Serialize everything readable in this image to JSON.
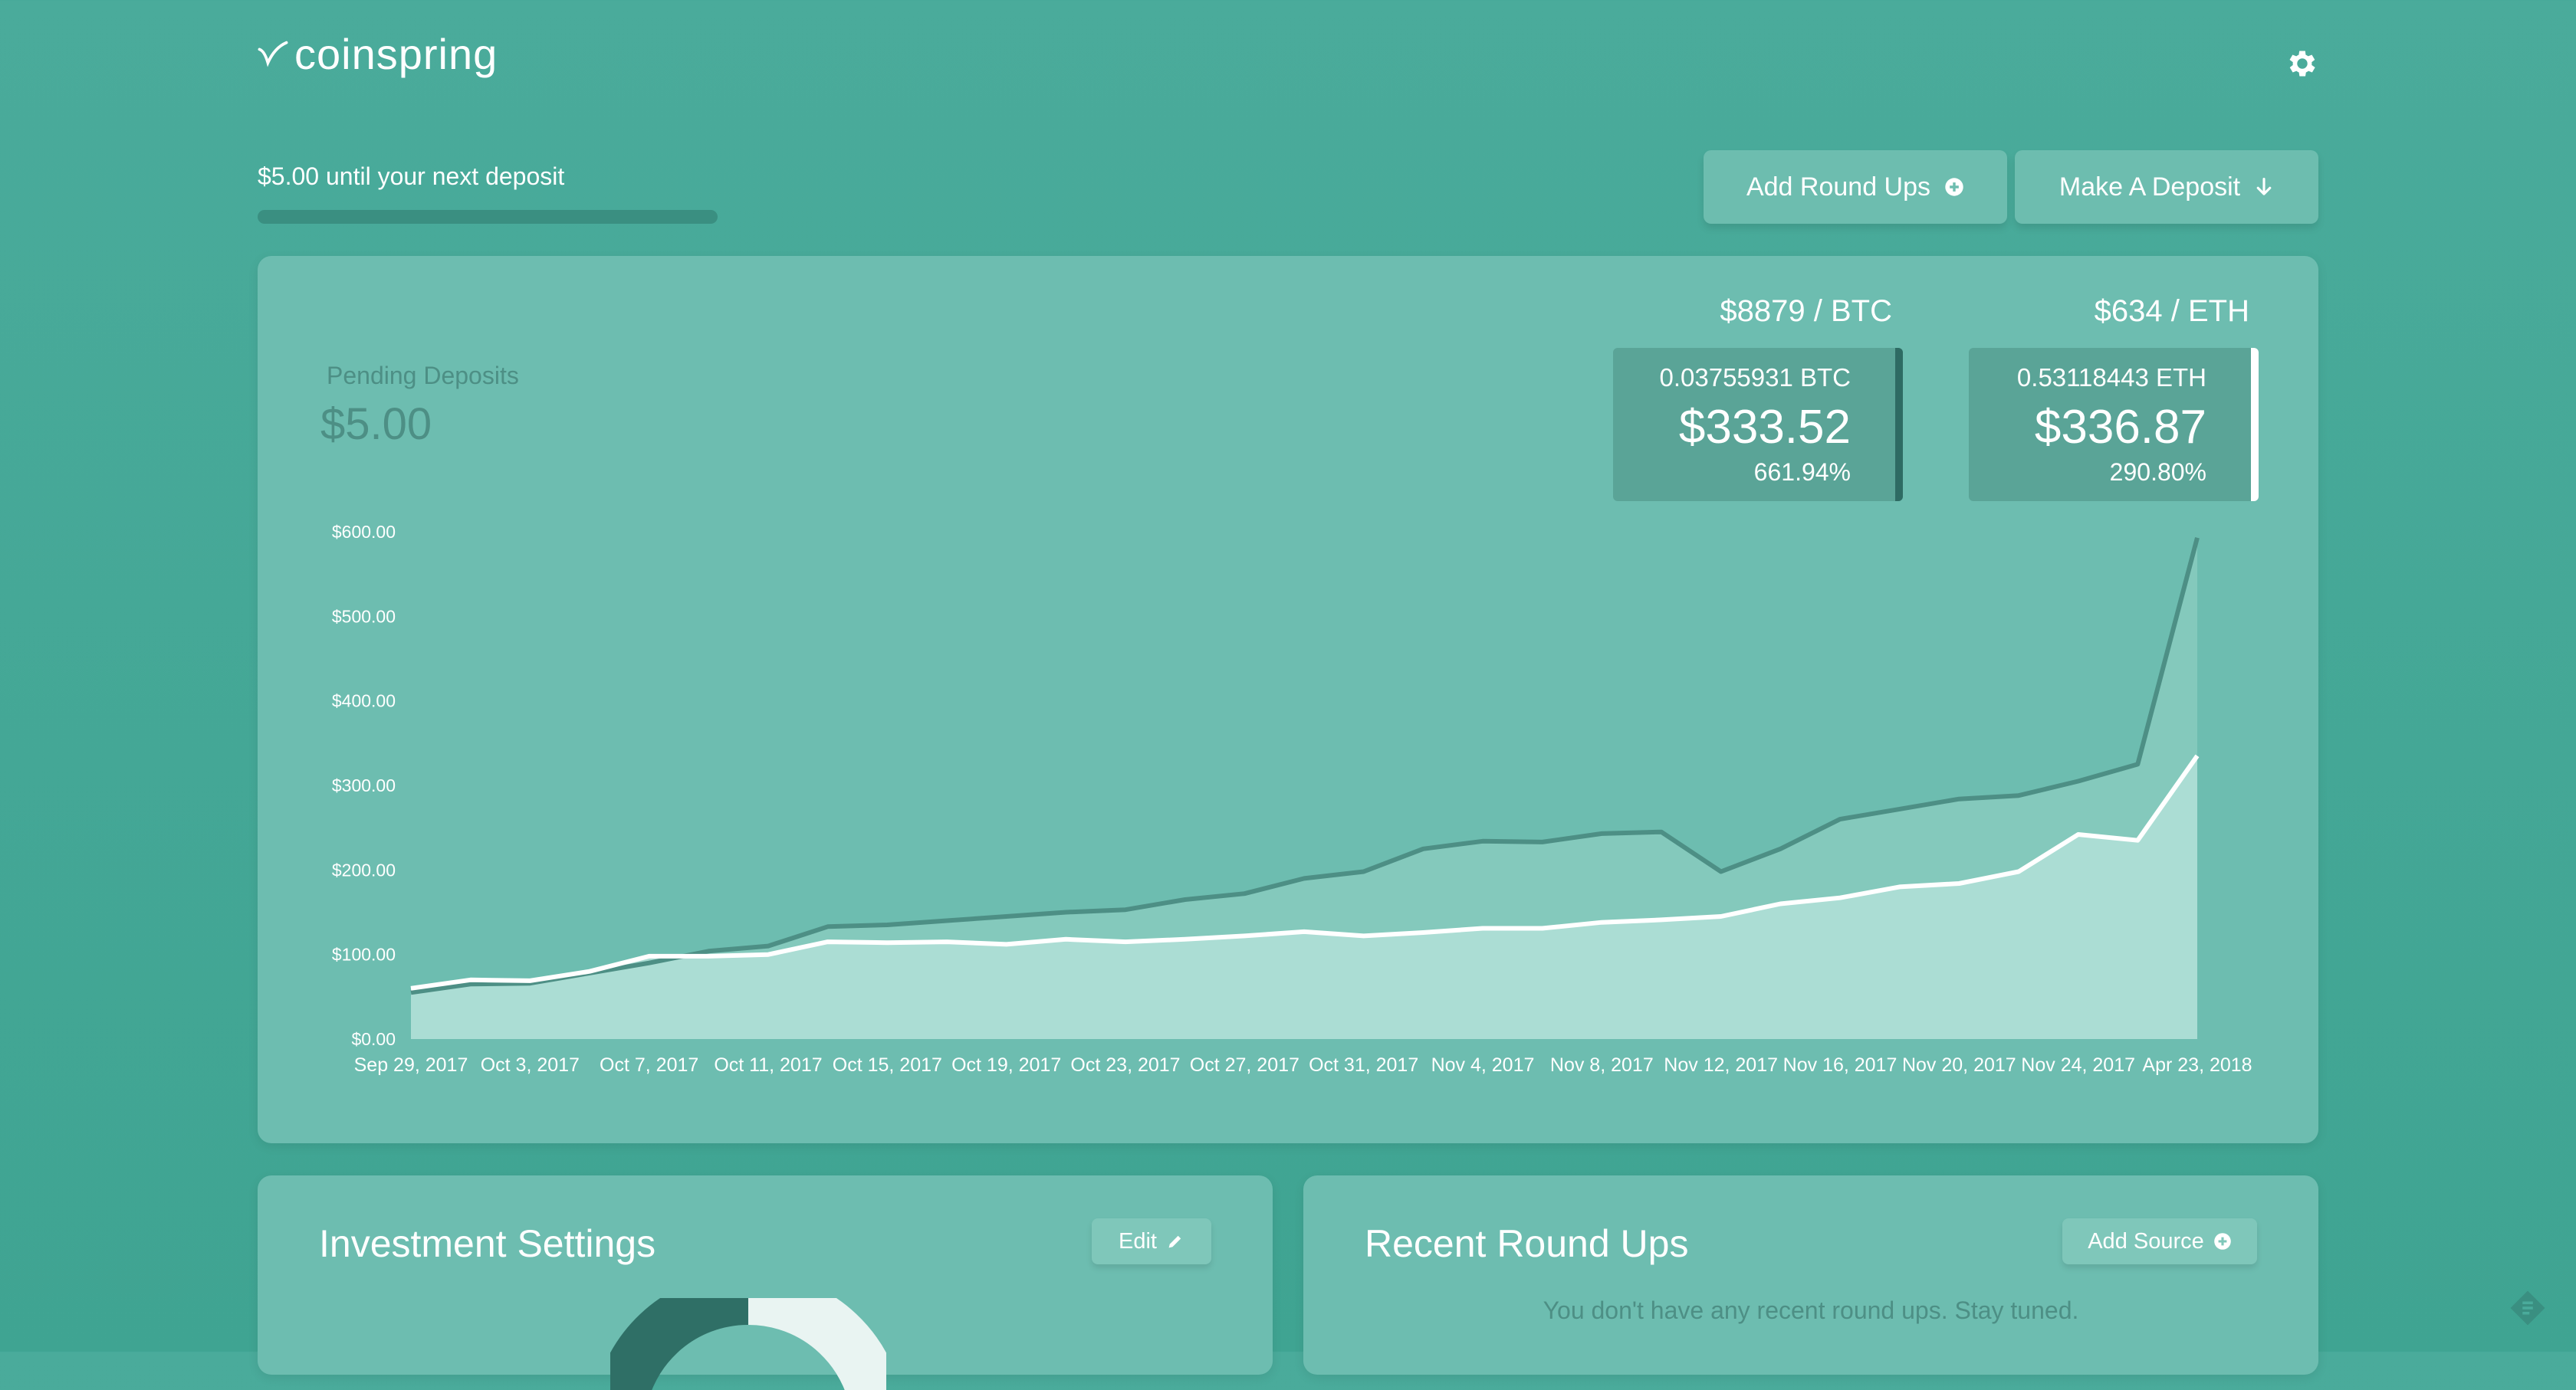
{
  "app": {
    "name": "coinspring"
  },
  "header": {
    "deposit_text": "$5.00 until your next deposit",
    "deposit_progress": 0,
    "buttons": {
      "add_round_ups": "Add Round Ups",
      "make_deposit": "Make A Deposit"
    }
  },
  "icons": {
    "settings": "gear-icon",
    "add": "plus-circle-icon",
    "deposit": "arrow-down-icon",
    "edit": "pencil-icon",
    "feedback": "feedback-icon"
  },
  "pending": {
    "label": "Pending Deposits",
    "value": "$5.00"
  },
  "coins": [
    {
      "price": "$8879 / BTC",
      "amount": "0.03755931 BTC",
      "usd": "$333.52",
      "pct": "661.94%",
      "edge_color": "#2e6b63"
    },
    {
      "price": "$634 / ETH",
      "amount": "0.53118443 ETH",
      "usd": "$336.87",
      "pct": "290.80%",
      "edge_color": "#ffffff"
    }
  ],
  "colors": {
    "background": "#45a898",
    "card": "#6dbdb0",
    "btc_line": "#4d8f85",
    "eth_line": "#ffffff"
  },
  "chart_data": {
    "type": "area",
    "y_tick_labels": [
      "$0.00",
      "$100.00",
      "$200.00",
      "$300.00",
      "$400.00",
      "$500.00",
      "$600.00"
    ],
    "ylim": [
      0,
      600
    ],
    "x_tick_labels": [
      "Sep 29, 2017",
      "Oct  3, 2017",
      "Oct  7, 2017",
      "Oct 11, 2017",
      "Oct 15, 2017",
      "Oct 19, 2017",
      "Oct 23, 2017",
      "Oct 27, 2017",
      "Oct 31, 2017",
      "Nov  4, 2017",
      "Nov  8, 2017",
      "Nov 12, 2017",
      "Nov 16, 2017",
      "Nov 20, 2017",
      "Nov 24, 2017",
      "Apr 23, 2018"
    ],
    "x": [
      "Sep 29, 2017",
      "Oct 1, 2017",
      "Oct 3, 2017",
      "Oct 5, 2017",
      "Oct 7, 2017",
      "Oct 9, 2017",
      "Oct 11, 2017",
      "Oct 13, 2017",
      "Oct 15, 2017",
      "Oct 17, 2017",
      "Oct 19, 2017",
      "Oct 21, 2017",
      "Oct 23, 2017",
      "Oct 25, 2017",
      "Oct 27, 2017",
      "Oct 29, 2017",
      "Oct 31, 2017",
      "Nov 2, 2017",
      "Nov 4, 2017",
      "Nov 6, 2017",
      "Nov 8, 2017",
      "Nov 10, 2017",
      "Nov 12, 2017",
      "Nov 14, 2017",
      "Nov 16, 2017",
      "Nov 18, 2017",
      "Nov 20, 2017",
      "Nov 22, 2017",
      "Nov 24, 2017",
      "Nov 26, 2017",
      "Apr 23, 2018"
    ],
    "series": [
      {
        "values": [
          55,
          65,
          66,
          78,
          90,
          104,
          110,
          133,
          135,
          140,
          145,
          150,
          153,
          165,
          172,
          190,
          198,
          225,
          234,
          233,
          243,
          245,
          198,
          225,
          260,
          272,
          284,
          288,
          305,
          325,
          593
        ],
        "color": "#4d8f85"
      },
      {
        "values": [
          60,
          70,
          69,
          80,
          98,
          98,
          100,
          115,
          114,
          115,
          112,
          118,
          115,
          118,
          122,
          127,
          122,
          126,
          131,
          131,
          138,
          141,
          145,
          160,
          167,
          180,
          184,
          198,
          242,
          235,
          335
        ],
        "color": "#ffffff"
      }
    ],
    "grid": false
  },
  "investment": {
    "title": "Investment Settings",
    "edit_label": "Edit"
  },
  "roundups": {
    "title": "Recent Round Ups",
    "add_source_label": "Add Source",
    "empty_text": "You don't have any recent round ups. Stay tuned."
  }
}
